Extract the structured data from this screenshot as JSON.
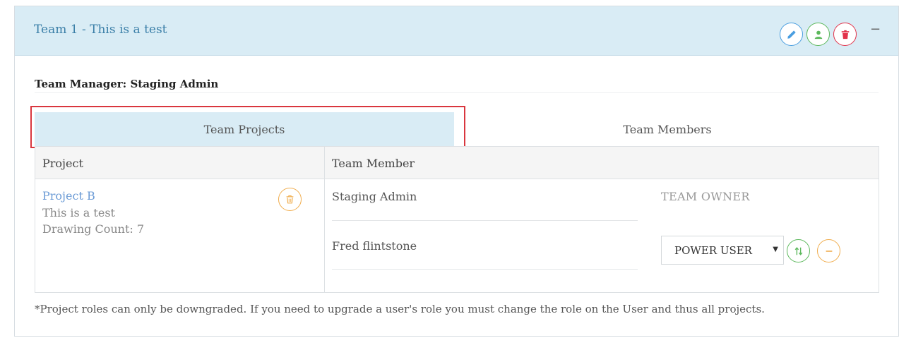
{
  "panel": {
    "title": "Team 1 - This is a test",
    "actions": {
      "edit_icon": "pencil-icon",
      "members_icon": "user-icon",
      "delete_icon": "trash-icon",
      "collapse_label": "−"
    }
  },
  "manager": {
    "label": "Team Manager: Staging Admin"
  },
  "tabs": [
    {
      "label": "Team Projects",
      "active": true
    },
    {
      "label": "Team Members",
      "active": false
    }
  ],
  "table": {
    "headers": {
      "project": "Project",
      "member": "Team Member"
    },
    "project": {
      "name": "Project B",
      "description": "This is a test",
      "drawing_count": "Drawing Count: 7"
    },
    "members": [
      {
        "name": "Staging Admin",
        "role": "TEAM OWNER"
      },
      {
        "name": "Fred flintstone",
        "role": "POWER USER"
      }
    ]
  },
  "footnote": "*Project roles can only be downgraded. If you need to upgrade a user's role you must change the role on the User and thus all projects.",
  "colors": {
    "header_bg": "#d9ecf5",
    "title": "#3b7fa8",
    "link": "#6b9bd6",
    "edit": "#4a9ee0",
    "success": "#5cb85c",
    "danger": "#e2334b",
    "warning": "#f0ad4e",
    "highlight": "#d9363e"
  }
}
